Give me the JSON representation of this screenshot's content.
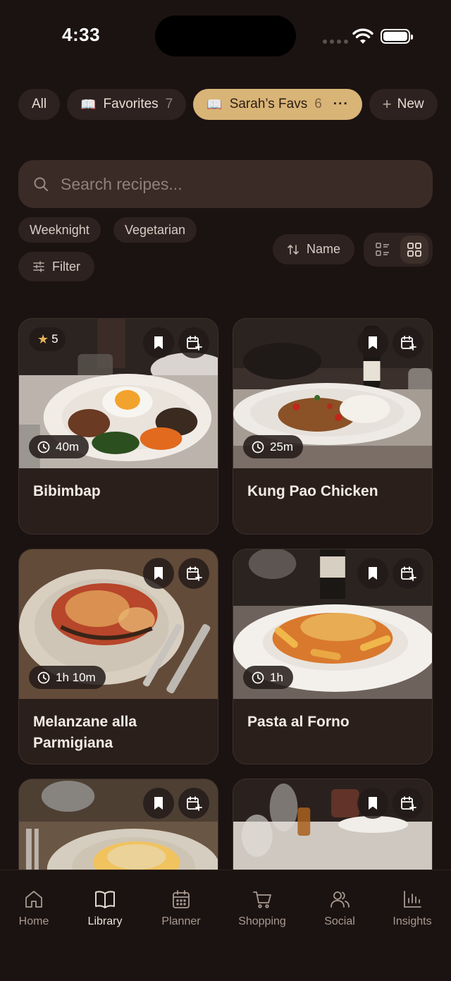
{
  "status_bar": {
    "time": "4:33"
  },
  "collections": [
    {
      "label": "All"
    },
    {
      "label": "Favorites",
      "count": "7"
    },
    {
      "label": "Sarah’s Favs",
      "count": "6"
    },
    {
      "label": "New"
    }
  ],
  "search": {
    "placeholder": "Search recipes..."
  },
  "tags": [
    "Weeknight",
    "Vegetarian"
  ],
  "filter_label": "Filter",
  "sort_label": "Name",
  "view_mode": "grid",
  "recipes": [
    {
      "title": "Bibimbap",
      "duration": "40m",
      "rating": "5"
    },
    {
      "title": "Kung Pao Chicken",
      "duration": "25m"
    },
    {
      "title": "Melanzane alla Parmigiana",
      "duration": "1h 10m"
    },
    {
      "title": "Pasta al Forno",
      "duration": "1h"
    },
    {
      "title": "",
      "duration": ""
    },
    {
      "title": "",
      "duration": ""
    }
  ],
  "nav": [
    {
      "label": "Home",
      "icon": "home-icon"
    },
    {
      "label": "Library",
      "icon": "book-icon",
      "active": true
    },
    {
      "label": "Planner",
      "icon": "calendar-icon"
    },
    {
      "label": "Shopping",
      "icon": "cart-icon"
    },
    {
      "label": "Social",
      "icon": "users-icon"
    },
    {
      "label": "Insights",
      "icon": "bar-chart-icon"
    }
  ],
  "colors": {
    "background": "#1b1311",
    "card": "#2a1f1b",
    "accent": "#d9b477",
    "star": "#e7b45b"
  }
}
